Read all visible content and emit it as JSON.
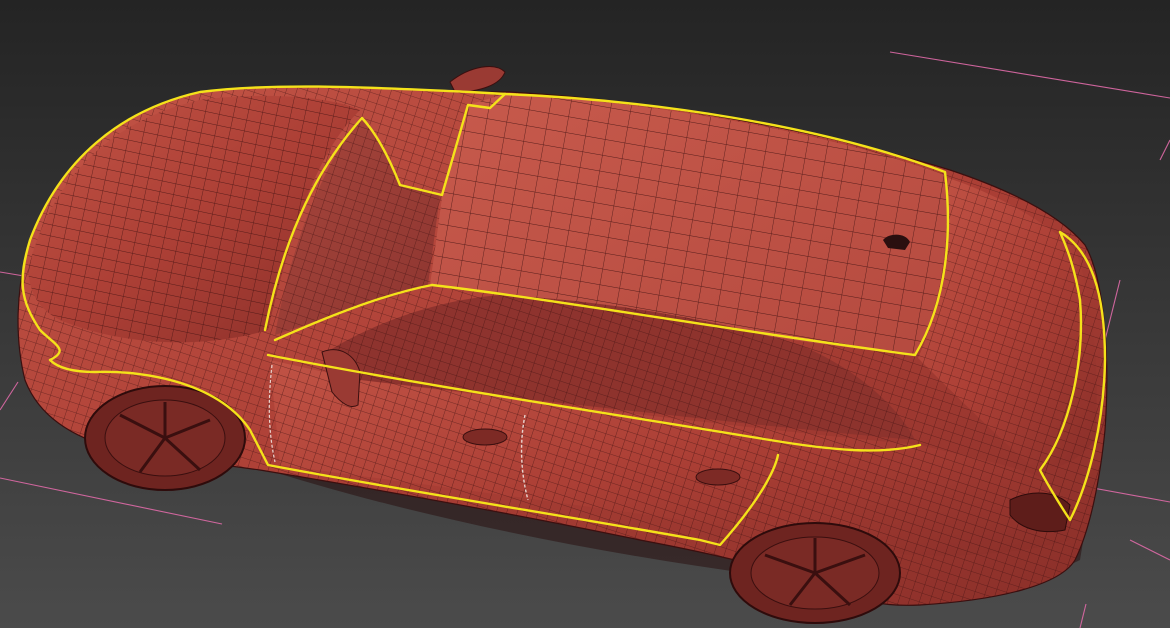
{
  "viewport": {
    "background_top": "#262626",
    "background_bottom": "#4a4a4a",
    "grid_line_color": "#e06aa8",
    "model_color": "#b9473d",
    "wire_color": "#4a1515",
    "selection_outline_color": "#f4e21a"
  },
  "scene": {
    "object": "station-wagon-car-model",
    "display_mode": "shaded-with-wireframe",
    "selection": "edge-loop-highlighted"
  }
}
